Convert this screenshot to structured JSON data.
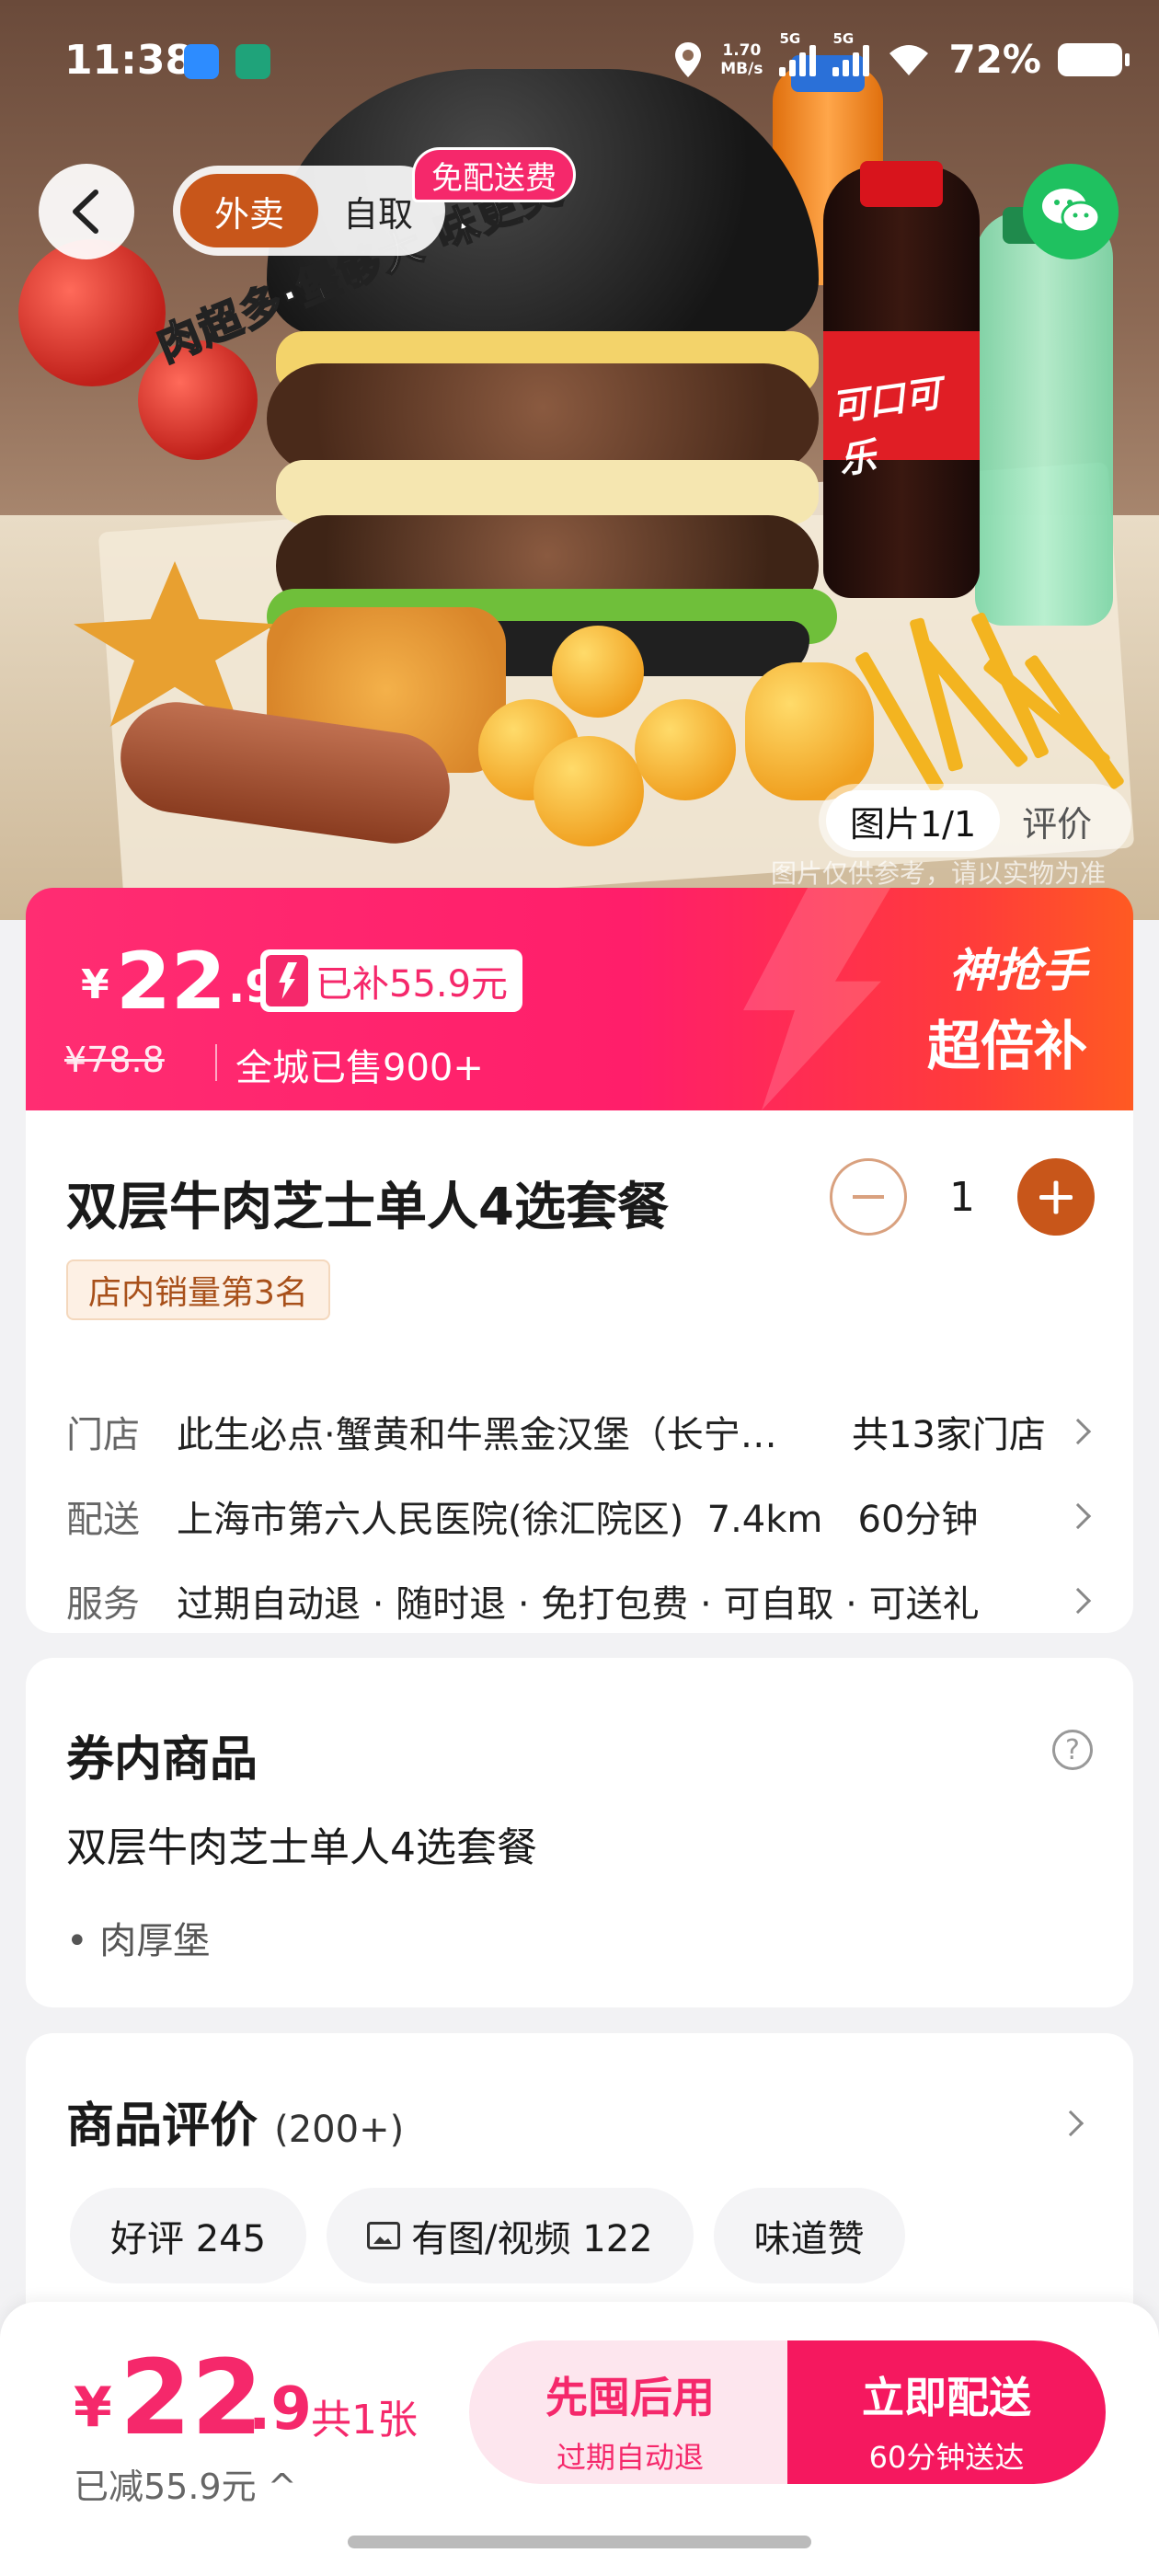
{
  "status_bar": {
    "time": "11:38",
    "net_speed": "1.70",
    "net_unit": "MB/s",
    "sig1": "5G",
    "sig2": "5G",
    "battery": "72%"
  },
  "hero": {
    "slogan": "肉超多·堡够大 味更美",
    "slogan_alt": "肉超",
    "cola_text": "可口可乐",
    "tabs": [
      "外卖",
      "自取"
    ],
    "free_delivery_badge": "免配送费",
    "image_counter": "图片1/1",
    "review_tab": "评价",
    "watermark": "图片仅供参考，请以实物为准"
  },
  "price_banner": {
    "currency": "¥",
    "price_int": "22",
    "price_dec": ".9",
    "subsidy": "已补55.9元",
    "original_price": "¥78.8",
    "sold": "全城已售900+",
    "brand_line1": "神抢手",
    "brand_line2": "超倍补"
  },
  "product": {
    "title": "双层牛肉芝士单人4选套餐",
    "quantity": "1",
    "rank_badge": "店内销量第3名",
    "store_label": "门店",
    "store_value": "此生必点·蟹黄和牛黑金汉堡（长宁…",
    "store_count": "共13家门店",
    "delivery_label": "配送",
    "delivery_value": "上海市第六人民医院(徐汇院区)  7.4km   60分钟",
    "service_label": "服务",
    "service_value": "过期自动退 · 随时退 · 免打包费 · 可自取 · 可送礼"
  },
  "voucher": {
    "title": "券内商品",
    "help": "?",
    "item": "双层牛肉芝士单人4选套餐",
    "sub_item": "• 肉厚堡"
  },
  "reviews": {
    "title": "商品评价",
    "count": "(200+)",
    "tags": [
      "好评 245",
      "有图/视频 122",
      "味道赞"
    ]
  },
  "bottom_bar": {
    "currency": "¥",
    "price_int": "22",
    "price_dec": ".9",
    "count": "共1张",
    "saved": "已减55.9元 ^",
    "btn_later_main": "先囤后用",
    "btn_later_sub": "过期自动退",
    "btn_now_main": "立即配送",
    "btn_now_sub": "60分钟送达"
  },
  "colors": {
    "accent": "#f5286b",
    "brand_orange": "#c8561a",
    "wechat_green": "#1fc160"
  }
}
